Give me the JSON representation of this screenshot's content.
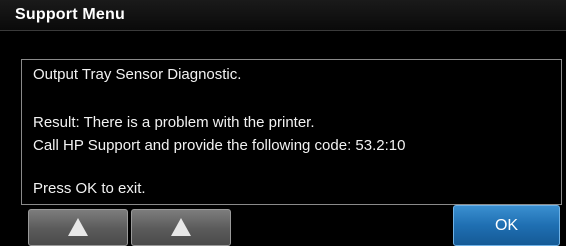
{
  "window": {
    "title": "Support Menu"
  },
  "message": {
    "line1": "Output Tray Sensor Diagnostic.",
    "line2": "Result: There is a problem with the printer.",
    "line3": "Call HP Support and provide the following code: 53.2:10",
    "line4": "Press OK to exit."
  },
  "buttons": {
    "ok_label": "OK",
    "up1_icon": "up-arrow-icon",
    "up2_icon": "up-arrow-icon"
  },
  "colors": {
    "background": "#000000",
    "ok_accent": "#1f6fb2",
    "nav_button": "#5a5a5a"
  }
}
